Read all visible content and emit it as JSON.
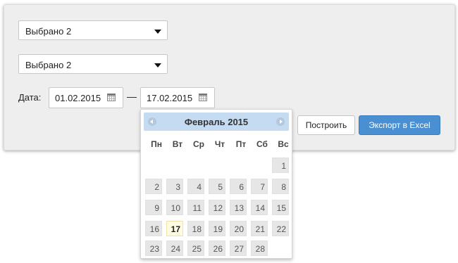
{
  "filters": {
    "select1": {
      "value": "Выбрано 2"
    },
    "select2": {
      "value": "Выбрано 2"
    }
  },
  "date_range": {
    "label": "Дата:",
    "from": "01.02.2015",
    "separator": "—",
    "to": "17.02.2015"
  },
  "actions": {
    "build_label": "Построить",
    "export_label": "Экспорт в Excel"
  },
  "datepicker": {
    "month_title": "Февраль 2015",
    "weekdays": [
      "Пн",
      "Вт",
      "Ср",
      "Чт",
      "Пт",
      "Сб",
      "Вс"
    ],
    "first_weekday_index": 6,
    "days_in_month": 28,
    "selected_day": 17
  },
  "colors": {
    "panel_bg": "#eeeeee",
    "header_bg": "#c4dbf2",
    "export_button": "#4a8fd2",
    "today_bg": "#fffbe3"
  }
}
